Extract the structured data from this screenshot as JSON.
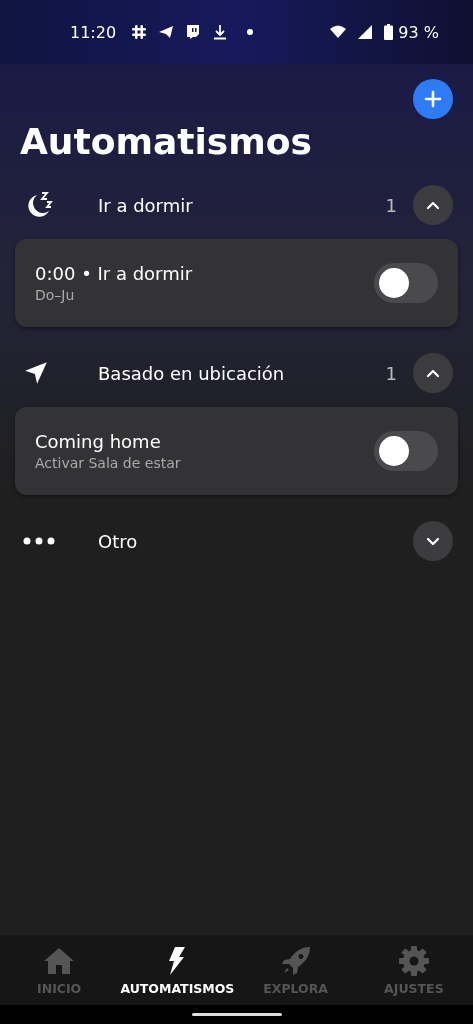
{
  "status_bar": {
    "time": "11:20",
    "notification_icons": [
      {
        "kind": "slack"
      },
      {
        "kind": "telegram"
      },
      {
        "kind": "twitch"
      },
      {
        "kind": "download"
      },
      {
        "kind": "dot"
      }
    ],
    "battery": "93 %"
  },
  "title": "Automatismos",
  "sections": [
    {
      "kind": "sleep",
      "label": "Ir a dormir",
      "count": "1",
      "expanded": true,
      "items": [
        {
          "title": "0:00 • Ir a dormir",
          "subtitle": "Do–Ju",
          "on": false
        }
      ]
    },
    {
      "kind": "location",
      "label": "Basado en ubicación",
      "count": "1",
      "expanded": true,
      "items": [
        {
          "title": "Coming home",
          "subtitle": "Activar Sala de estar",
          "on": false
        }
      ]
    },
    {
      "kind": "other",
      "label": "Otro",
      "expanded": false
    }
  ],
  "nav": [
    {
      "kind": "home",
      "label": "INICIO",
      "selected": false
    },
    {
      "kind": "bolt",
      "label": "AUTOMATISMOS",
      "selected": true
    },
    {
      "kind": "rocket",
      "label": "EXPLORA",
      "selected": false
    },
    {
      "kind": "gear",
      "label": "AJUSTES",
      "selected": false
    }
  ]
}
